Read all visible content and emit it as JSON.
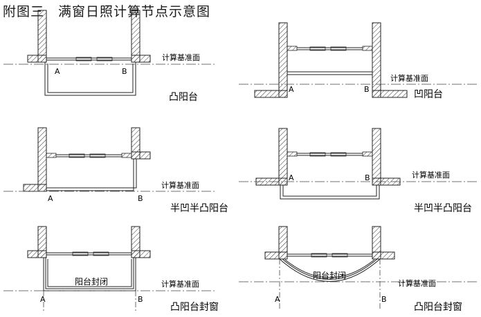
{
  "title": "附图三　满窗日照计算节点示意图",
  "reference_line_label": "计算基准面",
  "point_a": "A",
  "point_b": "B",
  "enclosure_label": "阳台封闭",
  "panels": [
    {
      "caption": "凸阳台"
    },
    {
      "caption": "凹阳台"
    },
    {
      "caption": "半凹半凸阳台"
    },
    {
      "caption": "半凹半凸阳台"
    },
    {
      "caption": "凸阳台封窗"
    },
    {
      "caption": "凸阳台封窗"
    }
  ]
}
